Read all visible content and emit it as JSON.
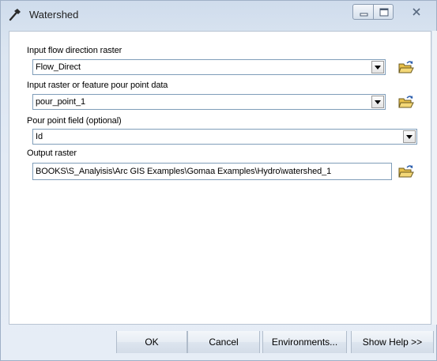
{
  "window": {
    "title": "Watershed",
    "icon": "hammer-icon"
  },
  "fields": {
    "flow_direction": {
      "label": "Input flow direction raster",
      "value": "Flow_Direct"
    },
    "pour_point_data": {
      "label": "Input raster or feature pour point data",
      "value": "pour_point_1"
    },
    "pour_point_field": {
      "label": "Pour point field (optional)",
      "value": "Id"
    },
    "output_raster": {
      "label": "Output raster",
      "value": "BOOKS\\S_Analyisis\\Arc GIS Examples\\Gomaa Examples\\Hydro\\watershed_1"
    }
  },
  "buttons": {
    "ok": "OK",
    "cancel": "Cancel",
    "environments": "Environments...",
    "show_help": "Show Help >>"
  },
  "colors": {
    "window_bg": "#dbe5f1",
    "field_border": "#7f9db9",
    "folder_yellow": "#e8c04a"
  }
}
